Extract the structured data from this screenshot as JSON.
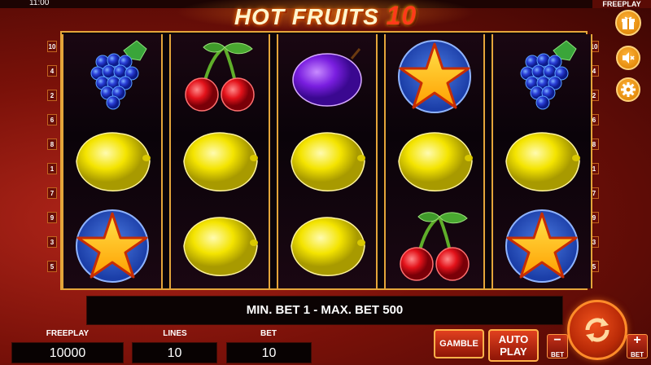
{
  "status": {
    "time": "11:00",
    "mode": "FREEPLAY"
  },
  "logo": {
    "main": "HOT FRUITS",
    "num": "10"
  },
  "reels": [
    [
      "grapes",
      "lemon",
      "star"
    ],
    [
      "cherries",
      "lemon",
      "lemon"
    ],
    [
      "plum",
      "lemon",
      "lemon"
    ],
    [
      "star",
      "lemon",
      "cherries"
    ],
    [
      "grapes",
      "lemon",
      "star"
    ]
  ],
  "paylines_left": [
    "10",
    "4",
    "2",
    "6",
    "8",
    "1",
    "7",
    "9",
    "3",
    "5"
  ],
  "paylines_right": [
    "10",
    "4",
    "2",
    "6",
    "8",
    "1",
    "7",
    "9",
    "3",
    "5"
  ],
  "message": "MIN. BET 1 - MAX. BET 500",
  "stats": {
    "freeplay_label": "FREEPLAY",
    "freeplay_value": "10000",
    "lines_label": "LINES",
    "lines_value": "10",
    "bet_label": "BET",
    "bet_value": "10"
  },
  "buttons": {
    "gamble": "GAMBLE",
    "auto_1": "AUTO",
    "auto_2": "PLAY",
    "bet_minus": "−",
    "bet_plus": "+",
    "bet_label": "BET"
  },
  "icons": {
    "gift": "gift-icon",
    "sound": "sound-off-icon",
    "settings": "gear-icon",
    "spin": "spin-arrows-icon"
  }
}
